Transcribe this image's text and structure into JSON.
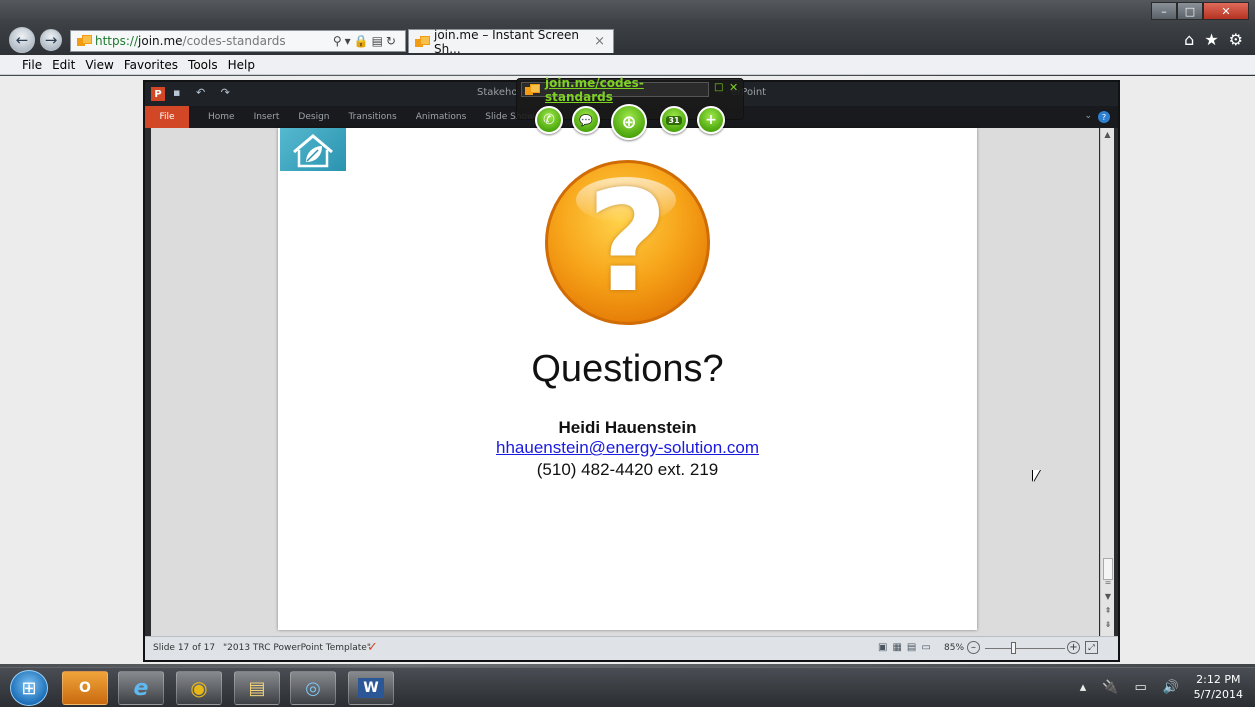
{
  "browser": {
    "address": {
      "scheme": "https://",
      "host": "join.me",
      "path": "/codes-standards",
      "icons": "⚲▾🔒▤↻"
    },
    "tab": {
      "title": "join.me – Instant Screen Sh...",
      "close": "×"
    },
    "menu": [
      "File",
      "Edit",
      "View",
      "Favorites",
      "Tools",
      "Help"
    ],
    "window_controls": {
      "minimize": "–",
      "maximize": "□",
      "close": "✕"
    },
    "toolbar_icons": {
      "home": "⌂",
      "favorites": "★",
      "settings": "⚙"
    }
  },
  "ppt": {
    "title_prefix": "Stakeho",
    "title_suffix": "erPoint",
    "logo": "P",
    "quick_access": "▪ ↶ ↷",
    "ribbon_tabs": [
      "File",
      "Home",
      "Insert",
      "Design",
      "Transitions",
      "Animations",
      "Slide Show"
    ],
    "help": "?",
    "collapse": "⌄",
    "slide": {
      "glyph": "?",
      "title": "Questions?",
      "name": "Heidi Hauenstein",
      "email": "hhauenstein@energy-solution.com",
      "phone": "(510) 482-4420 ext. 219"
    },
    "status": {
      "slide": "Slide 17 of 17",
      "theme": "\"2013 TRC PowerPoint Template\"",
      "spell": "✓",
      "zoom": "85%",
      "zoom_out": "–",
      "zoom_in": "+",
      "fit": "⤢",
      "views": [
        "▣",
        "▦",
        "▤",
        "▭"
      ]
    },
    "scroll": {
      "up": "▲",
      "down": "▼",
      "prev": "⇞",
      "next": "⇟",
      "split": "="
    }
  },
  "joinme": {
    "url": "join.me/codes-standards",
    "minimize": "□",
    "close": "✕",
    "buttons": {
      "call": "✆",
      "chat": "💬",
      "zoom": "⊕",
      "participants": "31",
      "add": "+"
    }
  },
  "taskbar": {
    "start": "⊞",
    "apps": [
      "O",
      "e",
      "◉",
      "▤",
      "◎",
      "W"
    ],
    "tray": [
      "▴",
      "🔌",
      "▭",
      "🔊"
    ],
    "time": "2:12 PM",
    "date": "5/7/2014"
  },
  "colors": {
    "accent_orange": "#d24726",
    "joinme_green": "#7ed321",
    "link_blue": "#1a1ae0"
  }
}
